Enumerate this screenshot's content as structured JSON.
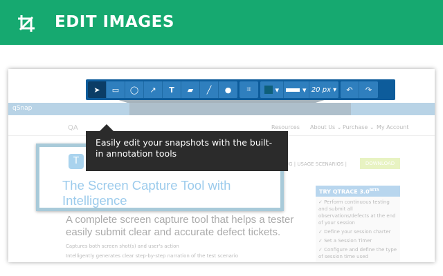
{
  "header": {
    "title": "EDIT IMAGES",
    "icon": "crop-icon",
    "bg": "#16a970"
  },
  "toolbar": {
    "size_label": "20 px",
    "color_swatch": "#0e5f7a"
  },
  "tooltip": {
    "text": "Easily edit your snapshots with the built-in annotation tools"
  },
  "screenshot": {
    "app_name": "qSnap",
    "logo_text": "QA",
    "nav": [
      "Resources",
      "About Us ⌄",
      "Purchase ⌄",
      "My Account"
    ],
    "links": "RICING | USAGE SCENARIOS |",
    "download": "DOWNLOAD",
    "headline": "The Screen Capture Tool with Intelligence",
    "subheadline": "A complete screen capture tool that helps a tester easily submit clear and accurate defect tickets.",
    "features": [
      "Captures both screen shot(s) and user's action",
      "Intelligently generates clear step-by-step narration of the test scenario"
    ],
    "sidebar": {
      "title": "TRY QTRACE 3.0",
      "badge": "BETA",
      "items": [
        "✓ Perform continuous testing and submit all observations/defects at the end of your session",
        "✓ Define your session charter",
        "✓ Set a Session Timer",
        "✓ Configure and define the type of session time used"
      ]
    }
  }
}
